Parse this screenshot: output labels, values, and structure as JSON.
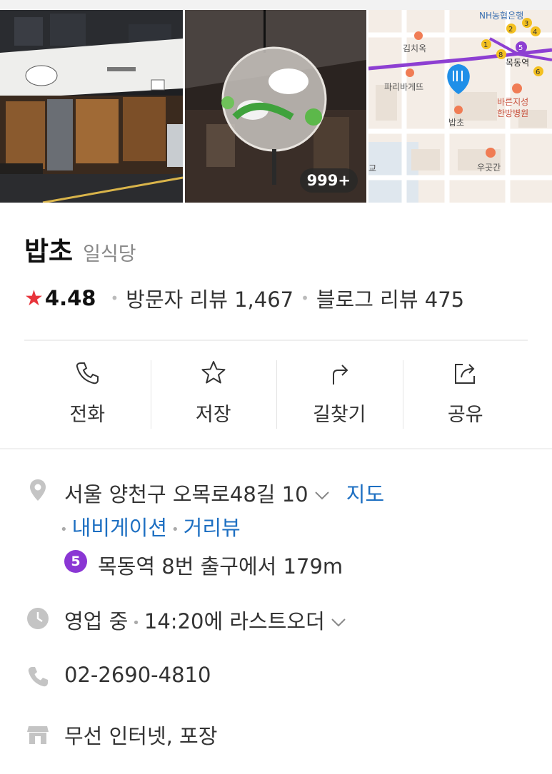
{
  "gallery": {
    "photo_count": "999+",
    "map": {
      "labels": [
        "NH농협은행",
        "김치옥",
        "파리바게뜨",
        "목동역",
        "바른지성 한방병원",
        "밥초",
        "우곳간",
        "교"
      ],
      "line_stations": [
        "1",
        "2",
        "3",
        "4",
        "5",
        "6",
        "8"
      ]
    }
  },
  "place": {
    "name": "밥초",
    "category": "일식당",
    "rating": "4.48",
    "visitor_reviews": "방문자 리뷰 1,467",
    "blog_reviews": "블로그 리뷰 475"
  },
  "actions": [
    {
      "label": "전화",
      "icon": "phone-icon"
    },
    {
      "label": "저장",
      "icon": "star-icon"
    },
    {
      "label": "길찾기",
      "icon": "directions-icon"
    },
    {
      "label": "공유",
      "icon": "share-icon"
    }
  ],
  "info": {
    "address": "서울 양천구 오목로48길 10",
    "map_link": "지도",
    "navigation_link": "내비게이션",
    "streetview_link": "거리뷰",
    "subway_line": "5",
    "subway_text": "목동역 8번 출구에서 179m",
    "hours_status": "영업 중",
    "hours_detail": "14:20에 라스트오더",
    "phone": "02-2690-4810",
    "amenities": "무선 인터넷, 포장"
  },
  "colors": {
    "accent_blue": "#1d6fc2",
    "rating_star": "#e8343b",
    "subway_line5": "#8a36d4",
    "map_pin": "#1f8fe8"
  }
}
